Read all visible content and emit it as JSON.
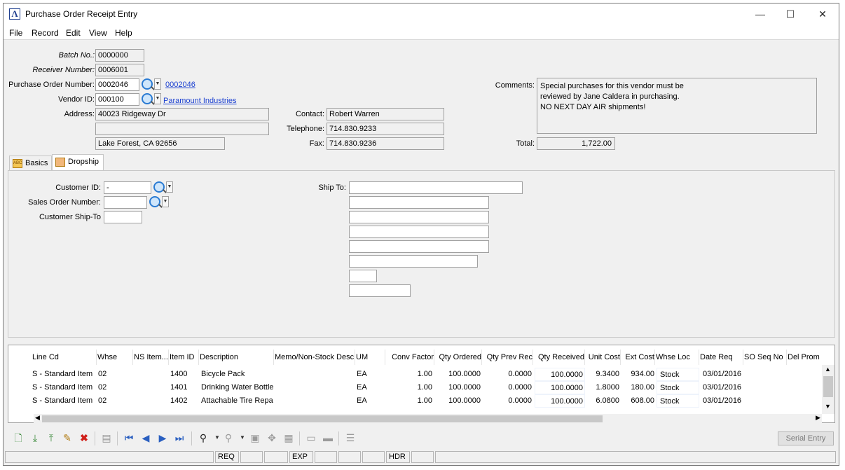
{
  "window": {
    "title": "Purchase Order Receipt Entry",
    "minimize": "—",
    "maximize": "☐",
    "close": "✕"
  },
  "menu": [
    "File",
    "Record",
    "Edit",
    "View",
    "Help"
  ],
  "header": {
    "batch_label": "Batch No.:",
    "batch_value": "0000000",
    "receiver_label": "Receiver Number:",
    "receiver_value": "0006001",
    "po_label": "Purchase Order Number:",
    "po_value": "0002046",
    "po_link": "0002046",
    "vendor_label": "Vendor ID:",
    "vendor_value": "000100",
    "vendor_link": "Paramount Industries",
    "address_label": "Address:",
    "address1": "40023 Ridgeway Dr",
    "address2": "",
    "address3": "Lake Forest, CA  92656",
    "contact_label": "Contact:",
    "contact_value": "Robert Warren",
    "telephone_label": "Telephone:",
    "telephone_value": "714.830.9233",
    "fax_label": "Fax:",
    "fax_value": "714.830.9236",
    "comments_label": "Comments:",
    "comments_value": "Special purchases for this vendor must be\nreviewed by Jane Caldera in purchasing.\nNO NEXT DAY AIR shipments!",
    "total_label": "Total:",
    "total_value": "1,722.00"
  },
  "tabs": [
    {
      "label": "Basics",
      "icon": "abc-icon",
      "active": false
    },
    {
      "label": "Dropship",
      "icon": "dropship-icon",
      "active": true
    }
  ],
  "dropship": {
    "customer_id_label": "Customer ID:",
    "customer_id_value": "-",
    "sales_order_label": "Sales Order Number:",
    "sales_order_value": "",
    "ship_to_code_label": "Customer Ship-To",
    "ship_to_code_value": "",
    "ship_to_label": "Ship To:"
  },
  "grid": {
    "columns": [
      "Line Cd",
      "Whse",
      "NS Item...",
      "Item ID",
      "Description",
      "Memo/Non-Stock Desc",
      "UM",
      "Conv Factor",
      "Qty Ordered",
      "Qty Prev Rec",
      "Qty Received",
      "Unit Cost",
      "Ext Cost",
      "Whse Loc",
      "Date Req",
      "SO Seq No",
      "Del Prom"
    ],
    "rows": [
      {
        "line_cd": "S - Standard Item",
        "whse": "02",
        "ns": "",
        "item": "1400",
        "desc": "Bicycle Pack",
        "memo": "",
        "um": "EA",
        "conv": "1.00",
        "ordered": "100.0000",
        "prev": "0.0000",
        "received": "100.0000",
        "unit_cost": "9.3400",
        "ext_cost": "934.00",
        "loc": "Stock",
        "date": "03/01/2016"
      },
      {
        "line_cd": "S - Standard Item",
        "whse": "02",
        "ns": "",
        "item": "1401",
        "desc": "Drinking Water Bottle",
        "memo": "",
        "um": "EA",
        "conv": "1.00",
        "ordered": "100.0000",
        "prev": "0.0000",
        "received": "100.0000",
        "unit_cost": "1.8000",
        "ext_cost": "180.00",
        "loc": "Stock",
        "date": "03/01/2016"
      },
      {
        "line_cd": "S - Standard Item",
        "whse": "02",
        "ns": "",
        "item": "1402",
        "desc": "Attachable Tire Repa",
        "memo": "",
        "um": "EA",
        "conv": "1.00",
        "ordered": "100.0000",
        "prev": "0.0000",
        "received": "100.0000",
        "unit_cost": "6.0800",
        "ext_cost": "608.00",
        "loc": "Stock",
        "date": "03/01/2016"
      }
    ]
  },
  "toolbar": {
    "serial_entry": "Serial Entry"
  },
  "status": {
    "req": "REQ",
    "exp": "EXP",
    "hdr": "HDR"
  }
}
